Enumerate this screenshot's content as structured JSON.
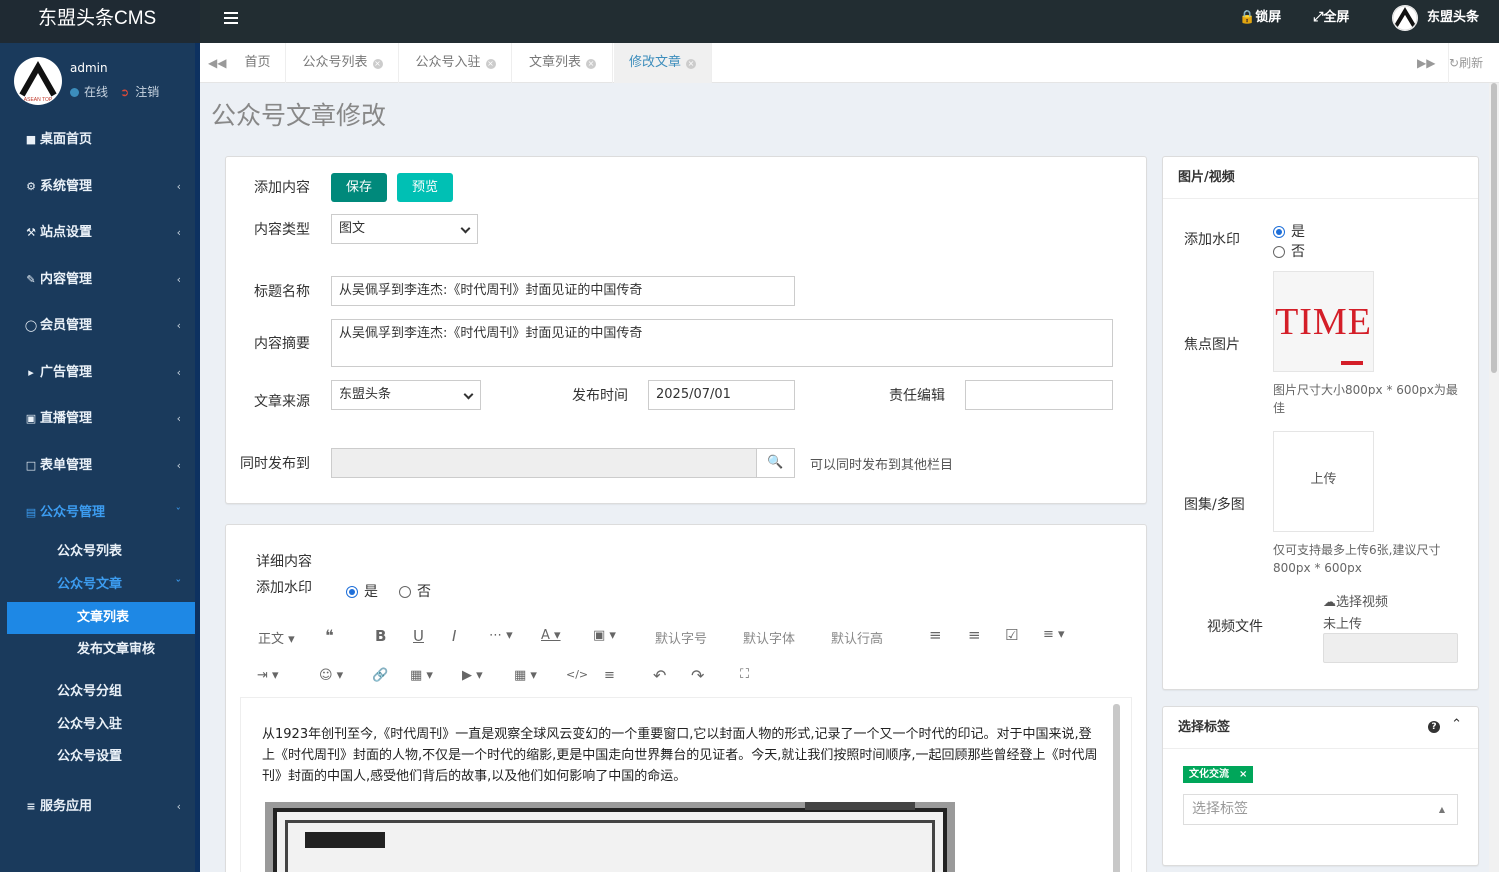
{
  "app": {
    "title": "东盟头条CMS"
  },
  "topbar": {
    "lock": "锁屏",
    "fullscreen": "全屏",
    "site": "东盟头条"
  },
  "user": {
    "name": "admin",
    "status": "在线",
    "logout": "注销"
  },
  "sidebar": {
    "items": [
      {
        "label": "桌面首页"
      },
      {
        "label": "系统管理"
      },
      {
        "label": "站点设置"
      },
      {
        "label": "内容管理"
      },
      {
        "label": "会员管理"
      },
      {
        "label": "广告管理"
      },
      {
        "label": "直播管理"
      },
      {
        "label": "表单管理"
      },
      {
        "label": "公众号管理"
      },
      {
        "label": "服务应用"
      }
    ],
    "sub": {
      "list": "公众号列表",
      "article": "公众号文章",
      "article_list": "文章列表",
      "review": "发布文章审核",
      "group": "公众号分组",
      "join": "公众号入驻",
      "settings": "公众号设置"
    }
  },
  "tabs": [
    {
      "label": "首页"
    },
    {
      "label": "公众号列表"
    },
    {
      "label": "公众号入驻"
    },
    {
      "label": "文章列表"
    },
    {
      "label": "修改文章"
    }
  ],
  "tabs_refresh": "刷新",
  "page": {
    "title": "公众号文章修改"
  },
  "form": {
    "add_content": "添加内容",
    "save": "保存",
    "preview": "预览",
    "content_type_label": "内容类型",
    "content_type": "图文",
    "title_label": "标题名称",
    "title_value": "从吴佩孚到李连杰:《时代周刊》封面见证的中国传奇",
    "summary_label": "内容摘要",
    "summary_value": "从吴佩孚到李连杰:《时代周刊》封面见证的中国传奇",
    "source_label": "文章来源",
    "source_value": "东盟头条",
    "time_label": "发布时间",
    "time_value": "2025/07/01",
    "editor_label": "责任编辑",
    "editor_value": "",
    "publish_to_label": "同时发布到",
    "publish_to_hint": "可以同时发布到其他栏目"
  },
  "detail": {
    "label": "详细内容",
    "watermark_label": "添加水印",
    "yes": "是",
    "no": "否",
    "toolbar": {
      "para": "正文",
      "font_size": "默认字号",
      "font_family": "默认字体",
      "line_height": "默认行高"
    },
    "body": "从1923年创刊至今,《时代周刊》一直是观察全球风云变幻的一个重要窗口,它以封面人物的形式,记录了一个又一个时代的印记。对于中国来说,登上《时代周刊》封面的人物,不仅是一个时代的缩影,更是中国走向世界舞台的见证者。今天,就让我们按照时间顺序,一起回顾那些曾经登上《时代周刊》封面的中国人,感受他们背后的故事,以及他们如何影响了中国的命运。"
  },
  "media": {
    "title": "图片/视频",
    "watermark_label": "添加水印",
    "yes": "是",
    "no": "否",
    "focus_label": "焦点图片",
    "focus_logo": "TIME",
    "focus_hint": "图片尺寸大小800px * 600px为最佳",
    "gallery_label": "图集/多图",
    "upload": "上传",
    "gallery_hint": "仅可支持最多上传6张,建议尺寸800px * 600px",
    "video_label": "视频文件",
    "video_select": "选择视频",
    "video_status": "未上传"
  },
  "tags": {
    "title": "选择标签",
    "chip": "文化交流",
    "placeholder": "选择标签"
  }
}
